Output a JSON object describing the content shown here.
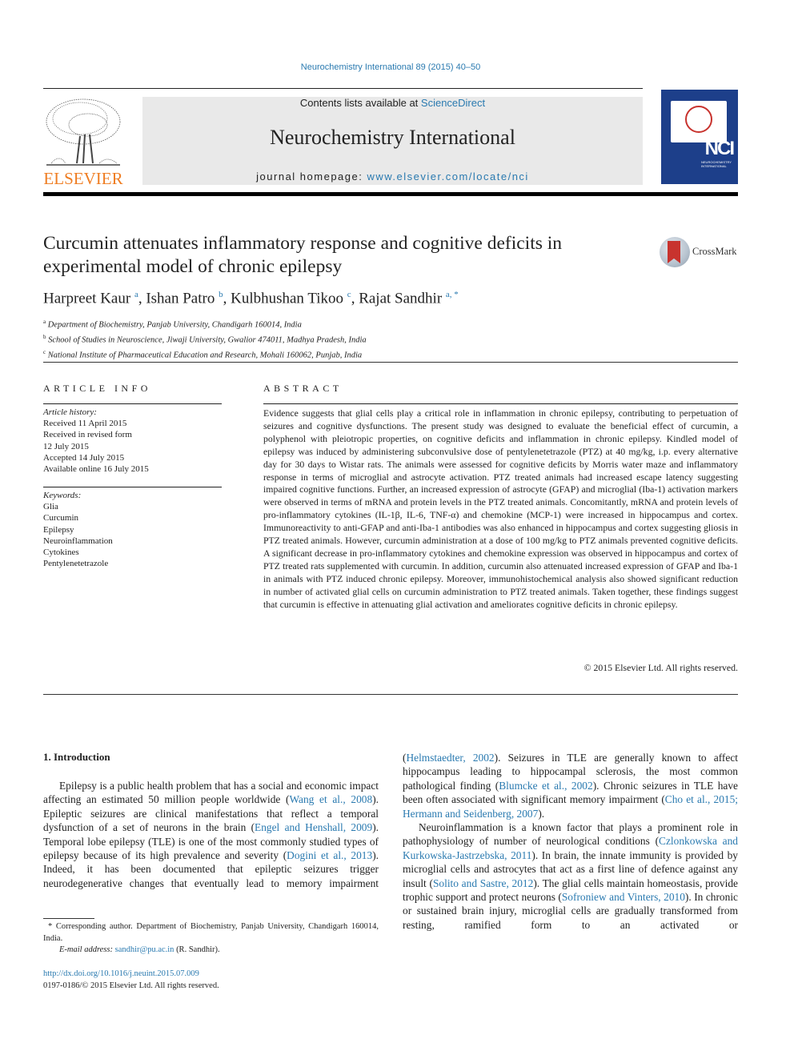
{
  "header": {
    "journal_ref": "Neurochemistry International 89 (2015) 40–50",
    "publisher_logo_text": "ELSEVIER",
    "contents_prefix": "Contents lists available at ",
    "contents_link": "ScienceDirect",
    "journal_title": "Neurochemistry International",
    "homepage_prefix": "journal homepage: ",
    "homepage_link": "www.elsevier.com/locate/nci",
    "cover_abbrev": "NCI",
    "cover_subtitle": "NEUROCHEMISTRY INTERNATIONAL",
    "colors": {
      "link": "#2a7ab0",
      "elsevier_orange": "#ef7d22",
      "cover_blue": "#1d3f8a",
      "crossmark_red": "#c8332e"
    }
  },
  "article": {
    "title": "Curcumin attenuates inflammatory response and cognitive deficits in experimental model of chronic epilepsy",
    "crossmark_label": "CrossMark",
    "authors": [
      {
        "name": "Harpreet Kaur",
        "sup": "a"
      },
      {
        "name": "Ishan Patro",
        "sup": "b"
      },
      {
        "name": "Kulbhushan Tikoo",
        "sup": "c"
      },
      {
        "name": "Rajat Sandhir",
        "sup": "a, *"
      }
    ],
    "affiliations": [
      {
        "sup": "a",
        "text": "Department of Biochemistry, Panjab University, Chandigarh 160014, India"
      },
      {
        "sup": "b",
        "text": "School of Studies in Neuroscience, Jiwaji University, Gwalior 474011, Madhya Pradesh, India"
      },
      {
        "sup": "c",
        "text": "National Institute of Pharmaceutical Education and Research, Mohali 160062, Punjab, India"
      }
    ]
  },
  "article_info": {
    "heading": "ARTICLE INFO",
    "history_label": "Article history:",
    "history": [
      "Received 11 April 2015",
      "Received in revised form",
      "12 July 2015",
      "Accepted 14 July 2015",
      "Available online 16 July 2015"
    ],
    "keywords_label": "Keywords:",
    "keywords": [
      "Glia",
      "Curcumin",
      "Epilepsy",
      "Neuroinflammation",
      "Cytokines",
      "Pentylenetetrazole"
    ]
  },
  "abstract": {
    "heading": "ABSTRACT",
    "text": "Evidence suggests that glial cells play a critical role in inflammation in chronic epilepsy, contributing to perpetuation of seizures and cognitive dysfunctions. The present study was designed to evaluate the beneficial effect of curcumin, a polyphenol with pleiotropic properties, on cognitive deficits and inflammation in chronic epilepsy. Kindled model of epilepsy was induced by administering sub­convulsive dose of pentylenetetrazole (PTZ) at 40 mg/kg, i.p. every alternative day for 30 days to Wis­tar rats. The animals were assessed for cognitive deficits by Morris water maze and inflammatory response in terms of microglial and astrocyte activation. PTZ treated animals had increased escape la­tency suggesting impaired cognitive functions. Further, an increased expression of astrocyte (GFAP) and microglial (Iba-1) activation markers were observed in terms of mRNA and protein levels in the PTZ treated animals. Concomitantly, mRNA and protein levels of pro-inflammatory cytokines (IL-1β, IL-6, TNF-α) and chemokine (MCP-1) were increased in hippocampus and cortex. Immunoreactivity to anti-GFAP and anti-Iba-1 antibodies was also enhanced in hippocampus and cortex suggesting gliosis in PTZ treated animals. However, curcumin administration at a dose of 100 mg/kg to PTZ animals prevented cognitive deficits. A significant decrease in pro-inflammatory cytokines and chemokine expression was observed in hippocampus and cortex of PTZ treated rats supplemented with curcumin. In addition, curcumin also attenuated increased expression of GFAP and Iba-1 in animals with PTZ induced chronic epilepsy. Moreover, immunohistochemical analysis also showed significant reduction in number of activated glial cells on curcumin administration to PTZ treated animals. Taken together, these findings suggest that curcumin is effective in attenuating glial activation and ameliorates cognitive deficits in chronic epilepsy.",
    "copyright": "© 2015 Elsevier Ltd. All rights reserved."
  },
  "introduction": {
    "heading": "1.  Introduction",
    "left_paragraph": [
      {
        "t": "Epilepsy is a public health problem that has a social and eco­nomic impact affecting an estimated 50 million people worldwide ("
      },
      {
        "link": "Wang et al., 2008"
      },
      {
        "t": "). Epileptic seizures are clinical manifestations that reflect a temporal dysfunction of a set of neurons in the brain ("
      },
      {
        "link": "Engel and Henshall, 2009"
      },
      {
        "t": "). Temporal lobe epilepsy (TLE) is one of the most commonly studied types of epilepsy because of its high prevalence and severity ("
      },
      {
        "link": "Dogini et al., 2013"
      },
      {
        "t": "). Indeed, it has been documented that epileptic seizures trigger neurodegenerative changes that eventually lead to memory impairment"
      }
    ],
    "right_paragraph_1": [
      {
        "t": "("
      },
      {
        "link": "Helmstaedter, 2002"
      },
      {
        "t": "). Seizures in TLE are generally known to affect hippocampus leading to hippocampal sclerosis, the most common pathological finding ("
      },
      {
        "link": "Blumcke et al., 2002"
      },
      {
        "t": "). Chronic seizures in TLE have been often associated with significant memory impairment ("
      },
      {
        "link": "Cho et al., 2015; Hermann and Seidenberg, 2007"
      },
      {
        "t": ")."
      }
    ],
    "right_paragraph_2": [
      {
        "t": "Neuroinflammation is a known factor that plays a prominent role in pathophysiology of number of neurological conditions ("
      },
      {
        "link": "Czlonkowska and Kurkowska-Jastrzebska, 2011"
      },
      {
        "t": "). In brain, the innate immunity is provided by microglial cells and astrocytes that act as a first line of defence against any insult ("
      },
      {
        "link": "Solito and Sastre, 2012"
      },
      {
        "t": "). The glial cells maintain homeostasis, provide tro­phic support and protect neurons ("
      },
      {
        "link": "Sofroniew and Vinters, 2010"
      },
      {
        "t": "). In chronic or sustained brain injury, microglial cells are gradually transformed from resting, ramified form to an activated or"
      }
    ]
  },
  "footnotes": {
    "corresponding": "* Corresponding author. Department of Biochemistry, Panjab University, Chan­digarh 160014, India.",
    "email_label": "E-mail address:",
    "email": "sandhir@pu.ac.in",
    "email_suffix": " (R. Sandhir).",
    "doi": "http://dx.doi.org/10.1016/j.neuint.2015.07.009",
    "issn": "0197-0186/© 2015 Elsevier Ltd. All rights reserved."
  }
}
